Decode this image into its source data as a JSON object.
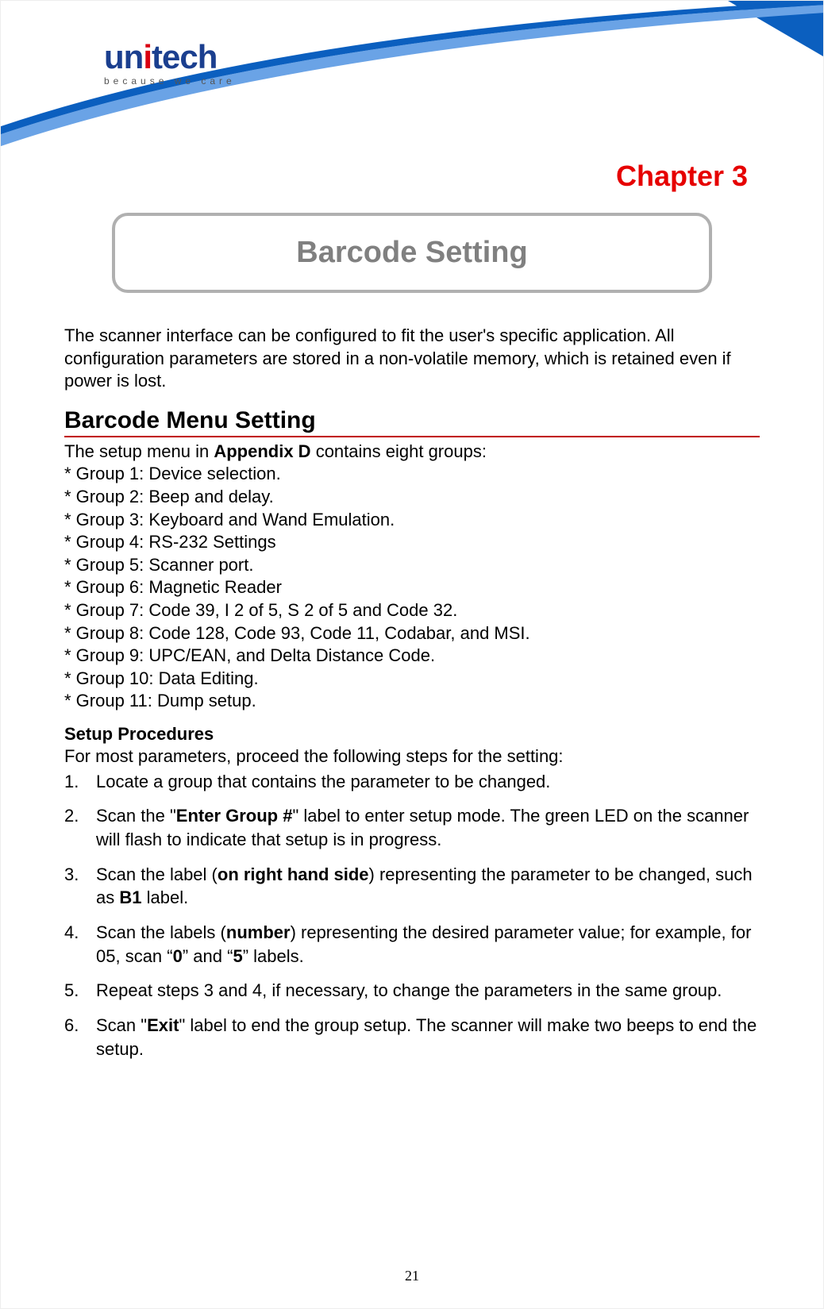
{
  "logo": {
    "name_pre": "un",
    "name_dot": "i",
    "name_post": "tech",
    "tagline": "because we care"
  },
  "chapter": "Chapter 3",
  "page_title": "Barcode Setting",
  "intro": "The scanner interface can be configured to fit the user's specific application. All configuration parameters are stored in a non-volatile memory, which is retained even if power is lost.",
  "section_heading": "Barcode Menu Setting",
  "setup_intro_pre": "The setup menu in ",
  "setup_intro_bold": "Appendix D",
  "setup_intro_post": " contains eight groups:",
  "groups": [
    "* Group 1: Device selection.",
    "* Group 2: Beep and delay.",
    "* Group 3: Keyboard and Wand Emulation.",
    "* Group 4: RS-232 Settings",
    "* Group 5: Scanner port.",
    "* Group 6: Magnetic Reader",
    "* Group 7: Code 39, I 2 of 5, S 2 of 5 and Code 32.",
    "* Group 8: Code 128, Code 93, Code 11, Codabar, and MSI.",
    "* Group 9: UPC/EAN, and Delta Distance Code.",
    "* Group 10: Data Editing.",
    "* Group 11: Dump setup."
  ],
  "subheading": "Setup Procedures",
  "procedures_intro": "For most parameters, proceed the following steps for the setting:",
  "steps": {
    "s1": {
      "num": "1.",
      "t0": "Locate a group that contains the parameter to be changed."
    },
    "s2": {
      "num": "2.",
      "t0": "Scan the \"",
      "b0": "Enter Group #",
      "t1": "\" label to enter setup mode. The green LED on the scanner will flash to indicate that setup is in progress."
    },
    "s3": {
      "num": "3.",
      "t0": "Scan the label (",
      "b0": "on right hand side",
      "t1": ") representing the parameter to be changed, such as ",
      "b1": "B1",
      "t2": " label."
    },
    "s4": {
      "num": "4.",
      "t0": "Scan the labels (",
      "b0": "number",
      "t1": ") representing the desired parameter value; for example, for 05, scan “",
      "b1": "0",
      "t2": "” and “",
      "b2": "5",
      "t3": "” labels."
    },
    "s5": {
      "num": "5.",
      "t0": "Repeat steps 3 and 4, if necessary, to change the parameters in the same group."
    },
    "s6": {
      "num": "6.",
      "t0": "Scan \"",
      "b0": "Exit",
      "t1": "\" label to end the group setup. The scanner will make two beeps to end the setup."
    }
  },
  "page_number": "21"
}
